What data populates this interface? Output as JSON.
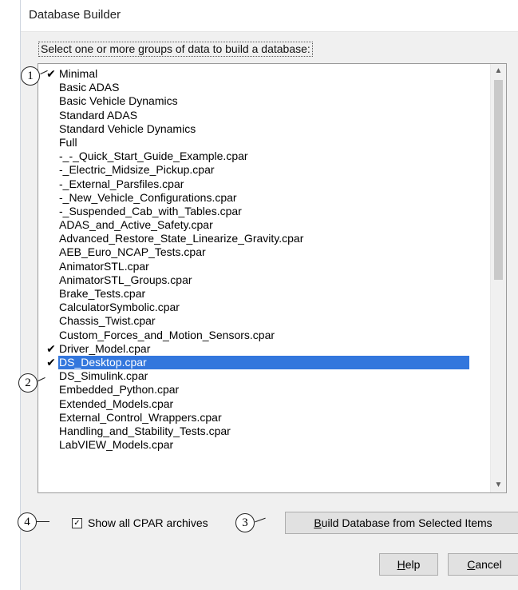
{
  "window": {
    "title": "Database Builder"
  },
  "prompt": "Select one or more groups of data to build a database:",
  "list_items": [
    {
      "label": "Minimal",
      "checked": true,
      "selected": false
    },
    {
      "label": "Basic ADAS",
      "checked": false,
      "selected": false
    },
    {
      "label": "Basic Vehicle Dynamics",
      "checked": false,
      "selected": false
    },
    {
      "label": "Standard ADAS",
      "checked": false,
      "selected": false
    },
    {
      "label": "Standard Vehicle Dynamics",
      "checked": false,
      "selected": false
    },
    {
      "label": "Full",
      "checked": false,
      "selected": false
    },
    {
      "label": "-_-_Quick_Start_Guide_Example.cpar",
      "checked": false,
      "selected": false
    },
    {
      "label": "-_Electric_Midsize_Pickup.cpar",
      "checked": false,
      "selected": false
    },
    {
      "label": "-_External_Parsfiles.cpar",
      "checked": false,
      "selected": false
    },
    {
      "label": "-_New_Vehicle_Configurations.cpar",
      "checked": false,
      "selected": false
    },
    {
      "label": "-_Suspended_Cab_with_Tables.cpar",
      "checked": false,
      "selected": false
    },
    {
      "label": "ADAS_and_Active_Safety.cpar",
      "checked": false,
      "selected": false
    },
    {
      "label": "Advanced_Restore_State_Linearize_Gravity.cpar",
      "checked": false,
      "selected": false
    },
    {
      "label": "AEB_Euro_NCAP_Tests.cpar",
      "checked": false,
      "selected": false
    },
    {
      "label": "AnimatorSTL.cpar",
      "checked": false,
      "selected": false
    },
    {
      "label": "AnimatorSTL_Groups.cpar",
      "checked": false,
      "selected": false
    },
    {
      "label": "Brake_Tests.cpar",
      "checked": false,
      "selected": false
    },
    {
      "label": "CalculatorSymbolic.cpar",
      "checked": false,
      "selected": false
    },
    {
      "label": "Chassis_Twist.cpar",
      "checked": false,
      "selected": false
    },
    {
      "label": "Custom_Forces_and_Motion_Sensors.cpar",
      "checked": false,
      "selected": false
    },
    {
      "label": "Driver_Model.cpar",
      "checked": true,
      "selected": false
    },
    {
      "label": "DS_Desktop.cpar",
      "checked": true,
      "selected": true
    },
    {
      "label": "DS_Simulink.cpar",
      "checked": false,
      "selected": false
    },
    {
      "label": "Embedded_Python.cpar",
      "checked": false,
      "selected": false
    },
    {
      "label": "Extended_Models.cpar",
      "checked": false,
      "selected": false
    },
    {
      "label": "External_Control_Wrappers.cpar",
      "checked": false,
      "selected": false
    },
    {
      "label": "Handling_and_Stability_Tests.cpar",
      "checked": false,
      "selected": false
    },
    {
      "label": "LabVIEW_Models.cpar",
      "checked": false,
      "selected": false
    }
  ],
  "show_all_checkbox": {
    "label": "Show all CPAR archives",
    "checked": true
  },
  "buttons": {
    "build": {
      "mnemonic": "B",
      "rest": "uild Database from Selected Items"
    },
    "help": {
      "mnemonic": "H",
      "rest": "elp"
    },
    "cancel": {
      "mnemonic": "C",
      "rest": "ancel"
    }
  },
  "callouts": {
    "c1": "1",
    "c2": "2",
    "c3": "3",
    "c4": "4"
  },
  "icons": {
    "check": "check-icon",
    "scroll_up": "chevron-up-icon",
    "scroll_down": "chevron-down-icon"
  },
  "colors": {
    "selection": "#3377dd",
    "dialog_bg": "#f0f0f0"
  }
}
